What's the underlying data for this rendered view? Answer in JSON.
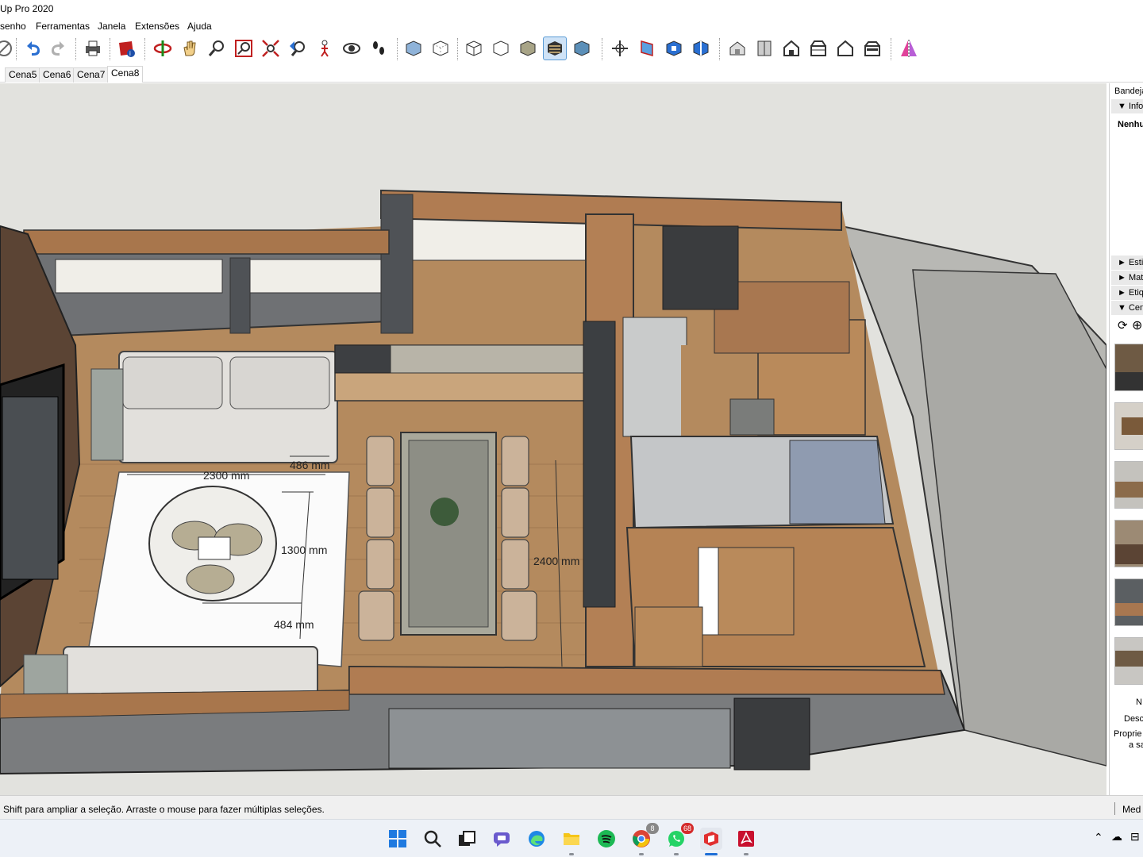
{
  "window": {
    "title": "Up Pro 2020"
  },
  "menu": [
    "senho",
    "Ferramentas",
    "Janela",
    "Extensões",
    "Ajuda"
  ],
  "toolbar": {
    "buttons": [
      "close-icon",
      "undo-icon",
      "redo-icon",
      "print-icon",
      "model-info-icon",
      "orbit-icon",
      "pan-icon",
      "zoom-icon",
      "zoom-window-icon",
      "zoom-extents-icon",
      "previous-view-icon",
      "position-camera-icon",
      "look-around-icon",
      "walk-icon",
      "xray-icon",
      "back-edges-icon",
      "wireframe-icon",
      "hidden-line-icon",
      "shaded-icon",
      "shaded-textures-icon",
      "monochrome-icon",
      "axes-icon",
      "section-plane-icon",
      "display-section-planes-icon",
      "display-section-cuts-icon",
      "iso-view-icon",
      "top-view-icon",
      "front-view-icon",
      "right-view-icon",
      "back-view-icon",
      "left-view-icon",
      "mirror-icon"
    ],
    "active": "shaded-textures-icon"
  },
  "scenes": {
    "tabs": [
      "Cena5",
      "Cena6",
      "Cena7",
      "Cena8"
    ],
    "active": "Cena8"
  },
  "viewport": {
    "dimensions": [
      "2300 mm",
      "486 mm",
      "1300 mm",
      "484 mm",
      "2400 mm"
    ]
  },
  "tray": {
    "title": "Bandeja",
    "entity_info": {
      "header": "Info",
      "selection": "Nenhu"
    },
    "panels": [
      "Esti",
      "Mat",
      "Etiq",
      "Cen"
    ],
    "scene_fields": [
      "N",
      "Desc",
      "Proprie",
      "a sa"
    ]
  },
  "status": {
    "hint": "Shift para ampliar a seleção. Arraste o mouse para fazer múltiplas seleções.",
    "measurements": "Med"
  },
  "taskbar": {
    "apps": [
      "start-icon",
      "search-icon",
      "task-view-icon",
      "teams-chat-icon",
      "edge-icon",
      "file-explorer-icon",
      "spotify-icon",
      "chrome-icon",
      "whatsapp-icon",
      "sketchup-icon",
      "acrobat-icon"
    ],
    "chrome_badge": "8",
    "whatsapp_badge": "68"
  }
}
